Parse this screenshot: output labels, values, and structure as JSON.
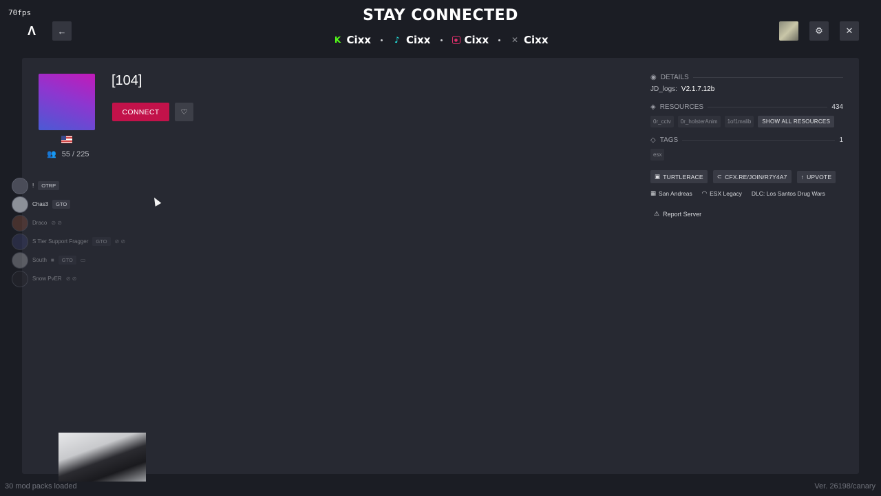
{
  "overlay": {
    "fps": "70fps"
  },
  "header": {
    "title": "STAY CONNECTED",
    "socials": [
      {
        "icon": "kick-icon",
        "label": "Cixx",
        "color": "#53fc18"
      },
      {
        "icon": "tiktok-icon",
        "label": "Cixx",
        "color": "#25f4ee"
      },
      {
        "icon": "instagram-icon",
        "label": "Cixx",
        "color": "#e1306c"
      },
      {
        "icon": "x-icon",
        "label": "Cixx",
        "color": "#8a8c92"
      }
    ]
  },
  "nav": {
    "back_icon": "←",
    "settings_icon": "⚙",
    "close_icon": "✕"
  },
  "server": {
    "name": "[104]",
    "players": "55 / 225",
    "connect_label": "CONNECT",
    "favorite_icon": "♡",
    "accent": "#c2124a"
  },
  "playerlist": [
    {
      "name": "!",
      "tag": "OTRP"
    },
    {
      "name": "Chas3",
      "tag": "GTO"
    },
    {
      "name": "Draco",
      "tag": ""
    },
    {
      "name": "S Tier Support Fragger",
      "tag": "GTO"
    },
    {
      "name": "South",
      "tag": "GTO"
    },
    {
      "name": "Snow PvER",
      "tag": ""
    }
  ],
  "details": {
    "heading": "DETAILS",
    "key": "JD_logs:",
    "value": "V2.1.7.12b"
  },
  "resources": {
    "heading": "RESOURCES",
    "count": "434",
    "items": [
      "0r_cctv",
      "0r_holsterAnim",
      "1of1malib"
    ],
    "show_all_label": "SHOW ALL RESOURCES"
  },
  "tags": {
    "heading": "TAGS",
    "count": "1",
    "items": [
      "esx"
    ]
  },
  "links": {
    "turtlerace": "TURTLERACE",
    "join": "CFX.RE/JOIN/R7Y4A7",
    "upvote": "UPVOTE"
  },
  "meta": {
    "map": "San Andreas",
    "gametype": "ESX Legacy",
    "dlc": "DLC: Los Santos Drug Wars"
  },
  "report_label": "Report Server",
  "footer": {
    "modpacks": "30 mod packs loaded",
    "version": "Ver. 26198/canary"
  }
}
